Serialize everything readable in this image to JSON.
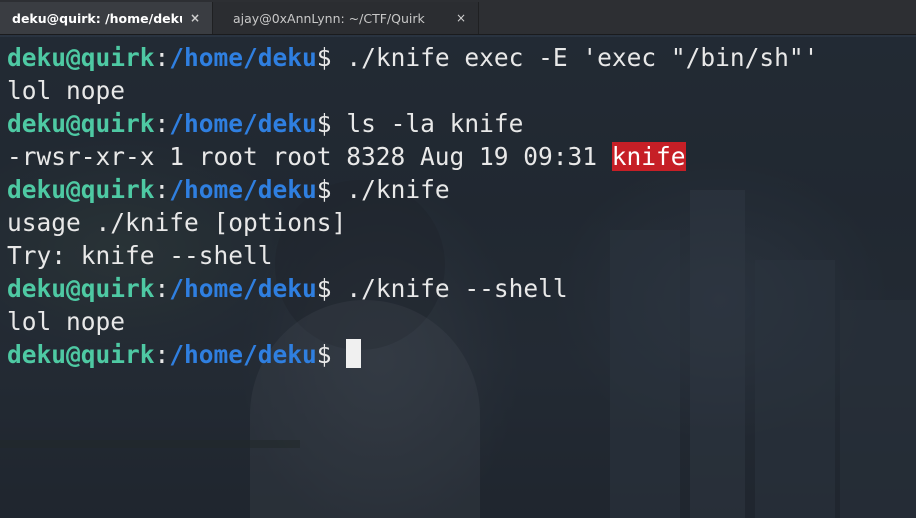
{
  "tabs": [
    {
      "label": "deku@quirk: /home/deku",
      "close": "×"
    },
    {
      "label": "ajay@0xAnnLynn: ~/CTF/Quirk",
      "close": "×"
    }
  ],
  "prompt": {
    "user": "deku@quirk",
    "colon": ":",
    "path": "/home/deku",
    "dollar": "$"
  },
  "lines": {
    "cmd1": " ./knife exec -E 'exec \"/bin/sh\"'",
    "out1": "lol nope",
    "cmd2": " ls -la knife",
    "out2_prefix": "-rwsr-xr-x 1 root root 8328 Aug 19 09:31 ",
    "out2_file": "knife",
    "cmd3": " ./knife",
    "out3a": "usage ./knife [options]",
    "out3b": "Try: knife --shell",
    "cmd4": " ./knife --shell",
    "out4": "lol nope"
  },
  "colors": {
    "user": "#4ec9a3",
    "path": "#2f7fe0",
    "highlight": "#c61f26"
  }
}
